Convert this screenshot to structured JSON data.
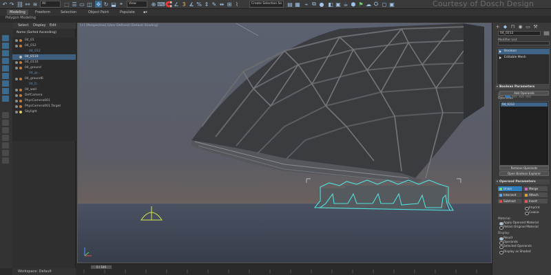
{
  "watermark": "Courtesy of Dosch Design",
  "toolbar": {
    "selection_filter": "All",
    "view_dropdown": "View",
    "selection_set": "Create Selection Se"
  },
  "ribbon": {
    "tabs": [
      "Modeling",
      "Freeform",
      "Selection",
      "Object Paint",
      "Populate"
    ],
    "subtitle": "Polygon Modeling"
  },
  "explorer": {
    "menu": [
      "Select",
      "Display",
      "Edit"
    ],
    "header": "Name (Sorted Ascending)",
    "rows": [
      "04_01",
      "04_012",
      "04_012",
      "04_0110",
      "04_0110",
      "04_ground",
      "04_gr...",
      "04_ground6",
      "04_0...",
      "04_wall",
      "DefCamera",
      "PhysCamera001",
      "PhysCamera001.Target",
      "Skylight"
    ],
    "workspace": "Workspace: Default"
  },
  "viewport": {
    "label": "[+] [Perspective] [User Defined] [Default Shading]"
  },
  "timeline": {
    "frame": "0 / 100"
  },
  "command_panel": {
    "object_name": "04_0212",
    "modifier_list": "Modifier List",
    "stack": [
      "Boolean",
      "Editable Mesh"
    ],
    "boolean_params": {
      "title": "Boolean Parameters",
      "add_operands": "Add Operands",
      "operands_label": "Operands",
      "operand_item": "04_0212",
      "remove_operands": "Remove Operands",
      "open_explorer": "Open Boolean Explorer"
    },
    "operand_params": {
      "title": "Operand Parameters",
      "union": "Union",
      "merge": "Merge",
      "intersect": "Intersect",
      "attach": "Attach",
      "subtract": "Subtract",
      "insert": "Insert",
      "imprint": "Imprint",
      "cookie": "Cookie",
      "material_label": "Material:",
      "apply_material": "Apply Operand Material",
      "retain_material": "Retain Original Material",
      "display_label": "Display:",
      "result": "Result",
      "operands": "Operands",
      "selected_operands": "Selected Operands",
      "display_shaded": "Display as Shaded"
    }
  }
}
